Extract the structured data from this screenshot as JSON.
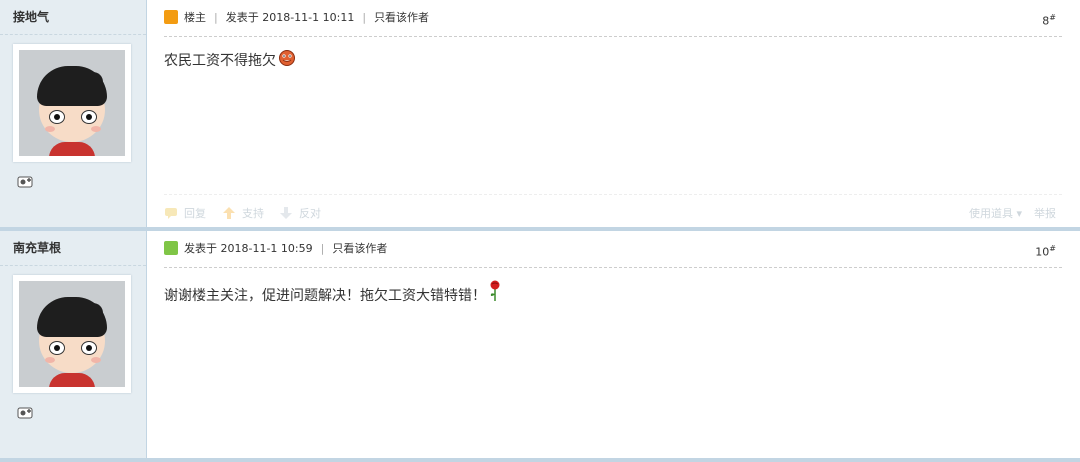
{
  "posts": [
    {
      "author": "接地气",
      "is_owner": true,
      "owner_label": "楼主",
      "posted": "发表于 2018-11-1 10:11",
      "only_author": "只看该作者",
      "floor": "8",
      "floor_sup": "#",
      "content": "农民工资不得拖欠",
      "emoji": "sticking-tongue-emoji",
      "actions": {
        "reply": "回复",
        "support": "支持",
        "against": "反对",
        "tools": "使用道具",
        "report": "举报"
      }
    },
    {
      "author": "南充草根",
      "is_owner": false,
      "posted": "发表于 2018-11-1 10:59",
      "only_author": "只看该作者",
      "floor": "10",
      "floor_sup": "#",
      "content": "谢谢楼主关注，促进问题解决！拖欠工资大错特错！",
      "emoji": "rose-emoji"
    }
  ],
  "colors": {
    "sidebar_bg": "#e5edf2",
    "separator": "#c2d5e3",
    "action_text": "#cfd7dd"
  }
}
